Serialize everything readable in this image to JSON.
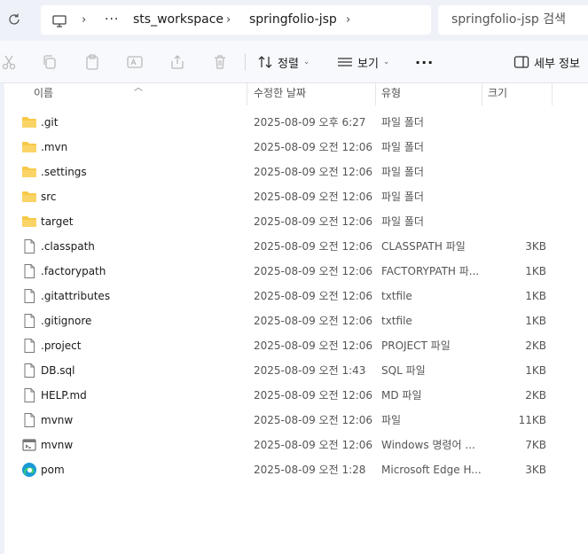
{
  "address_bar": {
    "breadcrumbs": [
      "sts_workspace",
      "springfolio-jsp"
    ],
    "overflow_glyph": "···",
    "search_placeholder": "springfolio-jsp 검색"
  },
  "toolbar": {
    "sort_label": "정렬",
    "view_label": "보기",
    "more_glyph": "···",
    "details_label": "세부 정보"
  },
  "columns": {
    "name": "이름",
    "date": "수정한 날짜",
    "type": "유형",
    "size": "크기"
  },
  "files": [
    {
      "name": ".git",
      "date": "2025-08-09 오후 6:27",
      "type": "파일 폴더",
      "size": "",
      "icon": "folder-icon"
    },
    {
      "name": ".mvn",
      "date": "2025-08-09 오전 12:06",
      "type": "파일 폴더",
      "size": "",
      "icon": "folder-icon"
    },
    {
      "name": ".settings",
      "date": "2025-08-09 오전 12:06",
      "type": "파일 폴더",
      "size": "",
      "icon": "folder-icon"
    },
    {
      "name": "src",
      "date": "2025-08-09 오전 12:06",
      "type": "파일 폴더",
      "size": "",
      "icon": "folder-icon"
    },
    {
      "name": "target",
      "date": "2025-08-09 오전 12:06",
      "type": "파일 폴더",
      "size": "",
      "icon": "folder-icon"
    },
    {
      "name": ".classpath",
      "date": "2025-08-09 오전 12:06",
      "type": "CLASSPATH 파일",
      "size": "3KB",
      "icon": "file-icon"
    },
    {
      "name": ".factorypath",
      "date": "2025-08-09 오전 12:06",
      "type": "FACTORYPATH 파...",
      "size": "1KB",
      "icon": "file-icon"
    },
    {
      "name": ".gitattributes",
      "date": "2025-08-09 오전 12:06",
      "type": "txtfile",
      "size": "1KB",
      "icon": "file-icon"
    },
    {
      "name": ".gitignore",
      "date": "2025-08-09 오전 12:06",
      "type": "txtfile",
      "size": "1KB",
      "icon": "file-icon"
    },
    {
      "name": ".project",
      "date": "2025-08-09 오전 12:06",
      "type": "PROJECT 파일",
      "size": "2KB",
      "icon": "file-icon"
    },
    {
      "name": "DB.sql",
      "date": "2025-08-09 오전 1:43",
      "type": "SQL 파일",
      "size": "1KB",
      "icon": "file-icon"
    },
    {
      "name": "HELP.md",
      "date": "2025-08-09 오전 12:06",
      "type": "MD 파일",
      "size": "2KB",
      "icon": "file-icon"
    },
    {
      "name": "mvnw",
      "date": "2025-08-09 오전 12:06",
      "type": "파일",
      "size": "11KB",
      "icon": "file-icon"
    },
    {
      "name": "mvnw",
      "date": "2025-08-09 오전 12:06",
      "type": "Windows 명령어 ...",
      "size": "7KB",
      "icon": "cmd-icon"
    },
    {
      "name": "pom",
      "date": "2025-08-09 오전 1:28",
      "type": "Microsoft Edge H...",
      "size": "3KB",
      "icon": "edge-icon"
    }
  ],
  "colors": {
    "folder": "#f8c948",
    "chrome_bg": "#eef2f8",
    "accent": "#1a6fc4"
  }
}
